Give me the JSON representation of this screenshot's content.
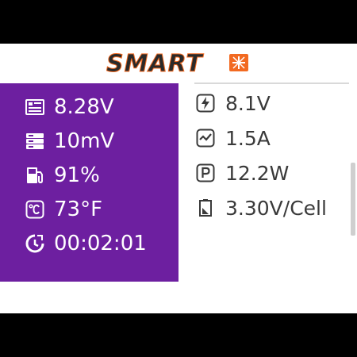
{
  "header": {
    "brand": "SMART"
  },
  "left_panel": {
    "items": [
      {
        "icon": "battery-voltage-icon",
        "value": "8.28V"
      },
      {
        "icon": "internal-resistance-icon",
        "value": "10mV"
      },
      {
        "icon": "fuel-gauge-icon",
        "value": "91%"
      },
      {
        "icon": "thermometer-celsius-icon",
        "value": "73°F"
      },
      {
        "icon": "timer-icon",
        "value": "00:02:01"
      }
    ]
  },
  "right_panel": {
    "items": [
      {
        "icon": "lightning-voltage-icon",
        "value": "8.1V"
      },
      {
        "icon": "current-check-icon",
        "value": "1.5A"
      },
      {
        "icon": "power-p-icon",
        "value": "12.2W"
      },
      {
        "icon": "cell-battery-icon",
        "value": "3.30V/Cell"
      }
    ]
  },
  "colors": {
    "accent_purple": "#6d1fa0",
    "logo_orange": "#f26a21",
    "text_dark": "#3a3a3a"
  }
}
